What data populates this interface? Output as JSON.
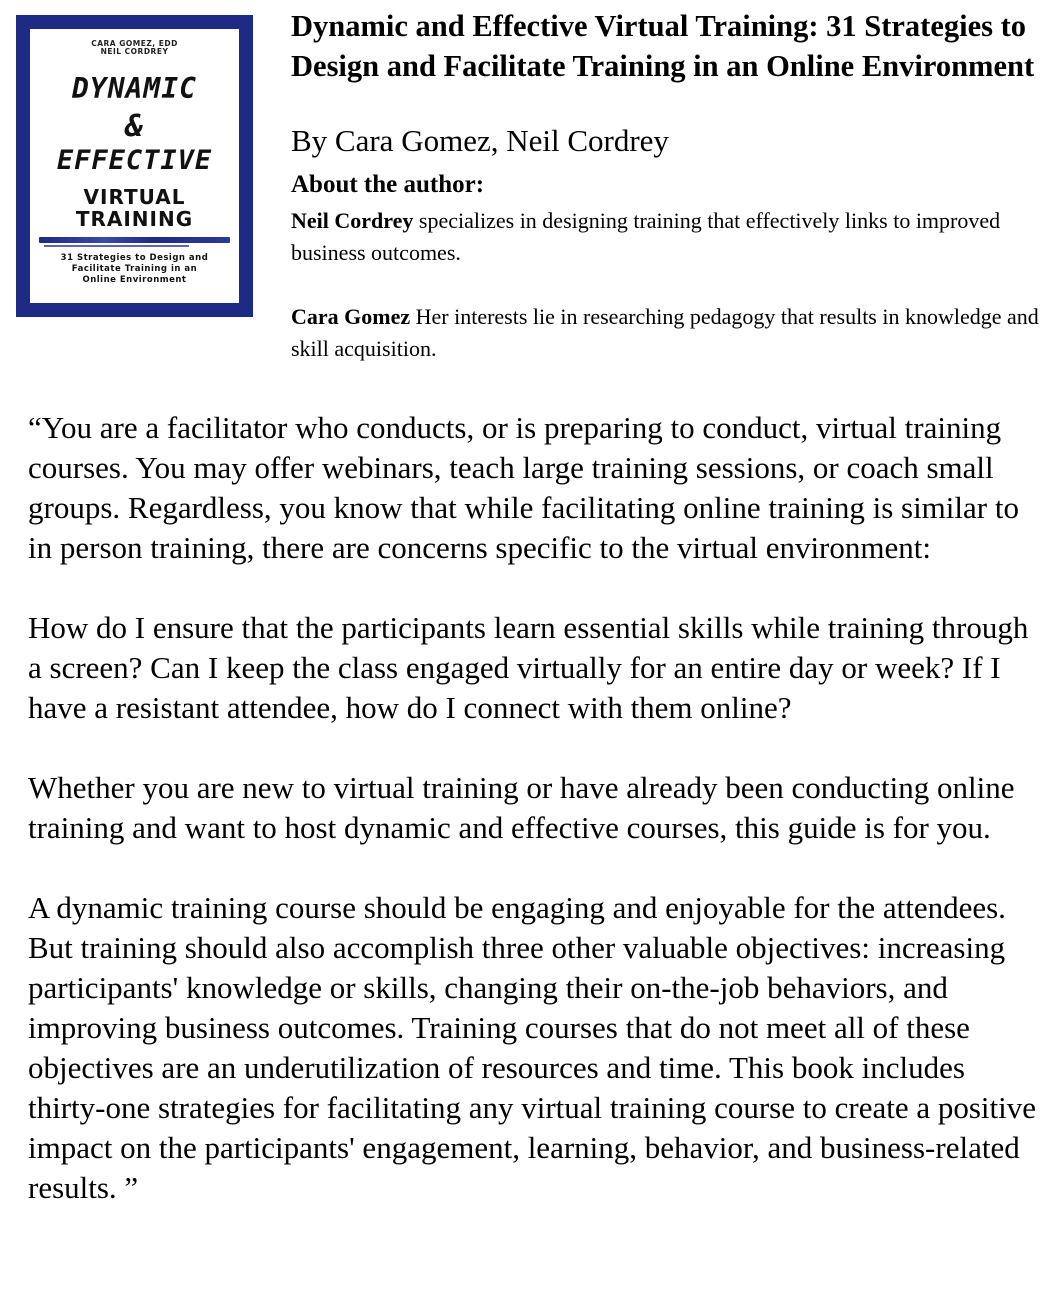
{
  "cover": {
    "authors": [
      "CARA GOMEZ, EDD",
      "NEIL CORDREY"
    ],
    "title_line1": "DYNAMIC",
    "title_amp": "&",
    "title_line2": "EFFECTIVE",
    "title_line3": "VIRTUAL",
    "title_line4": "TRAINING",
    "subtitle_lines": [
      "31 Strategies to Design and",
      "Facilitate Training in an",
      "Online Environment"
    ],
    "colors": {
      "frame": "#1d2b85",
      "background": "#ffffff"
    }
  },
  "book": {
    "title": "Dynamic and Effective Virtual Training: 31 Strategies to Design and Facilitate Training in an Online Environment",
    "byline": "By Cara Gomez, Neil Cordrey"
  },
  "about": {
    "heading": "About the author:",
    "authors": [
      {
        "name": "Neil Cordrey",
        "bio": " specializes in designing training that effectively links to improved business outcomes."
      },
      {
        "name": "Cara Gomez",
        "bio": " Her interests lie in researching pedagogy that results in knowledge and skill acquisition."
      }
    ]
  },
  "description": {
    "paragraphs": [
      "“You are a facilitator who conducts, or is preparing to conduct, virtual training courses. You may offer webinars, teach large training sessions, or coach small groups. Regardless, you know that while facilitating online training is similar to in person training, there are concerns specific to the virtual environment:",
      "How do I ensure that the participants learn essential skills while training through a screen? Can I keep the class engaged virtually for an entire day or week? If I have a resistant attendee, how do I connect with them online?",
      "Whether you are new to virtual training or have already been conducting online training and want to host dynamic and effective courses, this guide is for you.",
      "A dynamic training course should be engaging and enjoyable for the attendees. But training should also accomplish three other valuable objectives: increasing participants' knowledge or skills, changing their on-the-job behaviors, and improving business outcomes. Training courses that do not meet all of these objectives are an underutilization of resources and time. This book includes thirty-one strategies for facilitating any virtual training course to create a positive impact on the participants' engagement, learning, behavior, and business-related results. ”"
    ]
  }
}
